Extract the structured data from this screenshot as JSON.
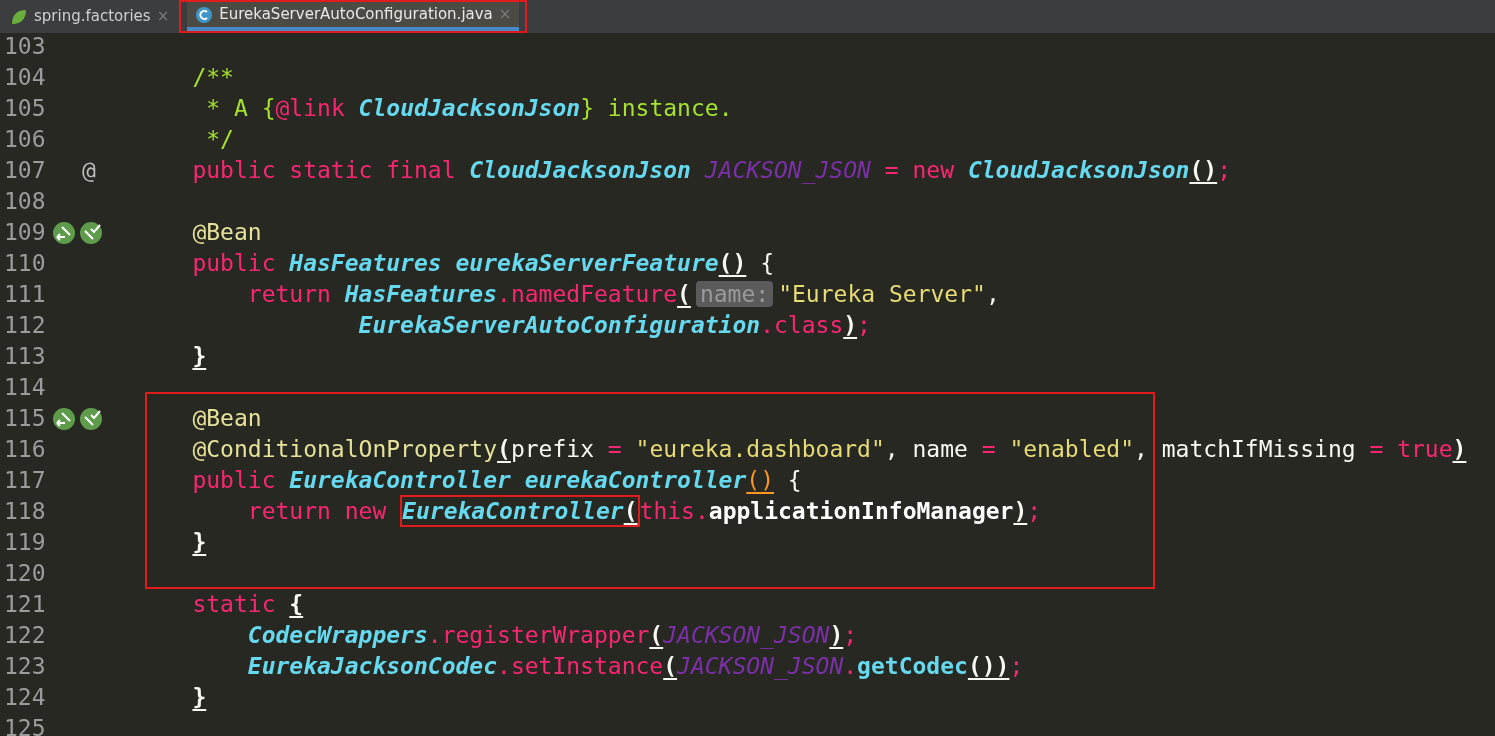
{
  "tabs": [
    {
      "label": "spring.factories",
      "selected": false,
      "boxed": false,
      "close": "×"
    },
    {
      "label": "EurekaServerAutoConfiguration.java",
      "selected": true,
      "boxed": true,
      "close": "×"
    }
  ],
  "editor": {
    "lines": [
      {
        "number": "103"
      },
      {
        "number": "104",
        "tokens": [
          {
            "kind": "doc",
            "text": "    /**"
          }
        ]
      },
      {
        "number": "105",
        "tokens": [
          {
            "kind": "doc",
            "text": "     * A {"
          },
          {
            "kind": "kw",
            "text": "@link "
          },
          {
            "kind": "type",
            "text": "CloudJacksonJson"
          },
          {
            "kind": "doc",
            "text": "} instance."
          }
        ]
      },
      {
        "number": "106",
        "tokens": [
          {
            "kind": "doc",
            "text": "     */"
          }
        ]
      },
      {
        "number": "107",
        "gutter": {
          "kind": "text",
          "text": "@"
        },
        "tokens": [
          {
            "kind": "kw",
            "text": "    public static final "
          },
          {
            "kind": "type",
            "text": "CloudJacksonJson "
          },
          {
            "kind": "const",
            "text": "JACKSON_JSON"
          },
          {
            "kind": "kw",
            "text": " = new "
          },
          {
            "kind": "type",
            "text": "CloudJacksonJson"
          },
          {
            "kind": "brace",
            "text": "()"
          },
          {
            "kind": "kw",
            "text": ";"
          }
        ]
      },
      {
        "number": "108"
      },
      {
        "number": "109",
        "gutter": {
          "kind": "bean"
        },
        "tokens": [
          {
            "kind": "ann",
            "text": "    @Bean"
          }
        ]
      },
      {
        "number": "110",
        "tokens": [
          {
            "kind": "kw",
            "text": "    public "
          },
          {
            "kind": "type",
            "text": "HasFeatures "
          },
          {
            "kind": "type",
            "text": "eurekaServerFeature"
          },
          {
            "kind": "brace",
            "text": "()"
          },
          {
            "kind": "plain",
            "text": " {"
          }
        ]
      },
      {
        "number": "111",
        "tokens": [
          {
            "kind": "kw",
            "text": "        return "
          },
          {
            "kind": "type",
            "text": "HasFeatures"
          },
          {
            "kind": "call",
            "text": ".namedFeature"
          },
          {
            "kind": "brace",
            "text": "("
          },
          {
            "kind": "hint",
            "text": "name:"
          },
          {
            "kind": "str",
            "text": "\"Eureka Server\""
          },
          {
            "kind": "plain",
            "text": ","
          }
        ]
      },
      {
        "number": "112",
        "tokens": [
          {
            "kind": "type",
            "text": "                EurekaServerAutoConfiguration"
          },
          {
            "kind": "call",
            "text": ".class"
          },
          {
            "kind": "brace",
            "text": ")"
          },
          {
            "kind": "kw",
            "text": ";"
          }
        ]
      },
      {
        "number": "113",
        "tokens": [
          {
            "kind": "brace",
            "text": "    }"
          }
        ]
      },
      {
        "number": "114"
      },
      {
        "number": "115",
        "framed": true,
        "gutter": {
          "kind": "bean"
        },
        "tokens": [
          {
            "kind": "ann",
            "text": "    @Bean"
          }
        ]
      },
      {
        "number": "116",
        "framed": true,
        "tokens": [
          {
            "kind": "ann",
            "text": "    @ConditionalOnProperty"
          },
          {
            "kind": "brace",
            "text": "("
          },
          {
            "kind": "plain",
            "text": "prefix "
          },
          {
            "kind": "kw",
            "text": "= "
          },
          {
            "kind": "str",
            "text": "\"eureka.dashboard\""
          },
          {
            "kind": "plain",
            "text": ", name "
          },
          {
            "kind": "kw",
            "text": "= "
          },
          {
            "kind": "str",
            "text": "\"enabled\""
          },
          {
            "kind": "plain",
            "text": ", matchIfMissing "
          },
          {
            "kind": "kw",
            "text": "= true"
          },
          {
            "kind": "brace",
            "text": ")"
          }
        ]
      },
      {
        "number": "117",
        "framed": true,
        "tokens": [
          {
            "kind": "kw",
            "text": "    public "
          },
          {
            "kind": "type",
            "text": "EurekaController "
          },
          {
            "kind": "type",
            "text": "eurekaController"
          },
          {
            "kind": "paren",
            "text": "()"
          },
          {
            "kind": "plain",
            "text": " {"
          }
        ]
      },
      {
        "number": "118",
        "framed": true,
        "tokens": [
          {
            "kind": "kw",
            "text": "        return new "
          },
          {
            "kind": "type",
            "text": "EurekaController",
            "boxed": true
          },
          {
            "kind": "brace",
            "text": "(",
            "boxed": true
          },
          {
            "kind": "kw",
            "text": "this."
          },
          {
            "kind": "bold",
            "text": "applicationInfoManager"
          },
          {
            "kind": "brace",
            "text": ")"
          },
          {
            "kind": "kw",
            "text": ";"
          }
        ]
      },
      {
        "number": "119",
        "framed": true,
        "tokens": [
          {
            "kind": "brace",
            "text": "    }"
          }
        ]
      },
      {
        "number": "120",
        "framed": true
      },
      {
        "number": "121",
        "tokens": [
          {
            "kind": "kw",
            "text": "    static "
          },
          {
            "kind": "brace",
            "text": "{"
          }
        ]
      },
      {
        "number": "122",
        "tokens": [
          {
            "kind": "type",
            "text": "        CodecWrappers"
          },
          {
            "kind": "call",
            "text": ".registerWrapper"
          },
          {
            "kind": "brace",
            "text": "("
          },
          {
            "kind": "const",
            "text": "JACKSON_JSON"
          },
          {
            "kind": "brace",
            "text": ")"
          },
          {
            "kind": "kw",
            "text": ";"
          }
        ]
      },
      {
        "number": "123",
        "tokens": [
          {
            "kind": "type",
            "text": "        EurekaJacksonCodec"
          },
          {
            "kind": "call",
            "text": ".setInstance"
          },
          {
            "kind": "brace",
            "text": "("
          },
          {
            "kind": "const",
            "text": "JACKSON_JSON"
          },
          {
            "kind": "call",
            "text": "."
          },
          {
            "kind": "fn",
            "text": "getCodec"
          },
          {
            "kind": "brace",
            "text": "())"
          },
          {
            "kind": "kw",
            "text": ";"
          }
        ]
      },
      {
        "number": "124",
        "tokens": [
          {
            "kind": "brace",
            "text": "    }"
          }
        ]
      },
      {
        "number": "125"
      }
    ]
  }
}
